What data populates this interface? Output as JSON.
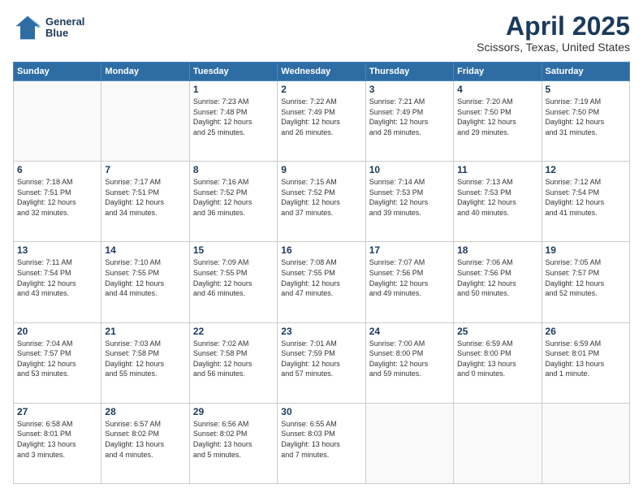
{
  "header": {
    "logo_line1": "General",
    "logo_line2": "Blue",
    "month": "April 2025",
    "location": "Scissors, Texas, United States"
  },
  "weekdays": [
    "Sunday",
    "Monday",
    "Tuesday",
    "Wednesday",
    "Thursday",
    "Friday",
    "Saturday"
  ],
  "weeks": [
    [
      {
        "day": "",
        "info": ""
      },
      {
        "day": "",
        "info": ""
      },
      {
        "day": "1",
        "info": "Sunrise: 7:23 AM\nSunset: 7:48 PM\nDaylight: 12 hours\nand 25 minutes."
      },
      {
        "day": "2",
        "info": "Sunrise: 7:22 AM\nSunset: 7:49 PM\nDaylight: 12 hours\nand 26 minutes."
      },
      {
        "day": "3",
        "info": "Sunrise: 7:21 AM\nSunset: 7:49 PM\nDaylight: 12 hours\nand 28 minutes."
      },
      {
        "day": "4",
        "info": "Sunrise: 7:20 AM\nSunset: 7:50 PM\nDaylight: 12 hours\nand 29 minutes."
      },
      {
        "day": "5",
        "info": "Sunrise: 7:19 AM\nSunset: 7:50 PM\nDaylight: 12 hours\nand 31 minutes."
      }
    ],
    [
      {
        "day": "6",
        "info": "Sunrise: 7:18 AM\nSunset: 7:51 PM\nDaylight: 12 hours\nand 32 minutes."
      },
      {
        "day": "7",
        "info": "Sunrise: 7:17 AM\nSunset: 7:51 PM\nDaylight: 12 hours\nand 34 minutes."
      },
      {
        "day": "8",
        "info": "Sunrise: 7:16 AM\nSunset: 7:52 PM\nDaylight: 12 hours\nand 36 minutes."
      },
      {
        "day": "9",
        "info": "Sunrise: 7:15 AM\nSunset: 7:52 PM\nDaylight: 12 hours\nand 37 minutes."
      },
      {
        "day": "10",
        "info": "Sunrise: 7:14 AM\nSunset: 7:53 PM\nDaylight: 12 hours\nand 39 minutes."
      },
      {
        "day": "11",
        "info": "Sunrise: 7:13 AM\nSunset: 7:53 PM\nDaylight: 12 hours\nand 40 minutes."
      },
      {
        "day": "12",
        "info": "Sunrise: 7:12 AM\nSunset: 7:54 PM\nDaylight: 12 hours\nand 41 minutes."
      }
    ],
    [
      {
        "day": "13",
        "info": "Sunrise: 7:11 AM\nSunset: 7:54 PM\nDaylight: 12 hours\nand 43 minutes."
      },
      {
        "day": "14",
        "info": "Sunrise: 7:10 AM\nSunset: 7:55 PM\nDaylight: 12 hours\nand 44 minutes."
      },
      {
        "day": "15",
        "info": "Sunrise: 7:09 AM\nSunset: 7:55 PM\nDaylight: 12 hours\nand 46 minutes."
      },
      {
        "day": "16",
        "info": "Sunrise: 7:08 AM\nSunset: 7:55 PM\nDaylight: 12 hours\nand 47 minutes."
      },
      {
        "day": "17",
        "info": "Sunrise: 7:07 AM\nSunset: 7:56 PM\nDaylight: 12 hours\nand 49 minutes."
      },
      {
        "day": "18",
        "info": "Sunrise: 7:06 AM\nSunset: 7:56 PM\nDaylight: 12 hours\nand 50 minutes."
      },
      {
        "day": "19",
        "info": "Sunrise: 7:05 AM\nSunset: 7:57 PM\nDaylight: 12 hours\nand 52 minutes."
      }
    ],
    [
      {
        "day": "20",
        "info": "Sunrise: 7:04 AM\nSunset: 7:57 PM\nDaylight: 12 hours\nand 53 minutes."
      },
      {
        "day": "21",
        "info": "Sunrise: 7:03 AM\nSunset: 7:58 PM\nDaylight: 12 hours\nand 55 minutes."
      },
      {
        "day": "22",
        "info": "Sunrise: 7:02 AM\nSunset: 7:58 PM\nDaylight: 12 hours\nand 56 minutes."
      },
      {
        "day": "23",
        "info": "Sunrise: 7:01 AM\nSunset: 7:59 PM\nDaylight: 12 hours\nand 57 minutes."
      },
      {
        "day": "24",
        "info": "Sunrise: 7:00 AM\nSunset: 8:00 PM\nDaylight: 12 hours\nand 59 minutes."
      },
      {
        "day": "25",
        "info": "Sunrise: 6:59 AM\nSunset: 8:00 PM\nDaylight: 13 hours\nand 0 minutes."
      },
      {
        "day": "26",
        "info": "Sunrise: 6:59 AM\nSunset: 8:01 PM\nDaylight: 13 hours\nand 1 minute."
      }
    ],
    [
      {
        "day": "27",
        "info": "Sunrise: 6:58 AM\nSunset: 8:01 PM\nDaylight: 13 hours\nand 3 minutes."
      },
      {
        "day": "28",
        "info": "Sunrise: 6:57 AM\nSunset: 8:02 PM\nDaylight: 13 hours\nand 4 minutes."
      },
      {
        "day": "29",
        "info": "Sunrise: 6:56 AM\nSunset: 8:02 PM\nDaylight: 13 hours\nand 5 minutes."
      },
      {
        "day": "30",
        "info": "Sunrise: 6:55 AM\nSunset: 8:03 PM\nDaylight: 13 hours\nand 7 minutes."
      },
      {
        "day": "",
        "info": ""
      },
      {
        "day": "",
        "info": ""
      },
      {
        "day": "",
        "info": ""
      }
    ]
  ]
}
